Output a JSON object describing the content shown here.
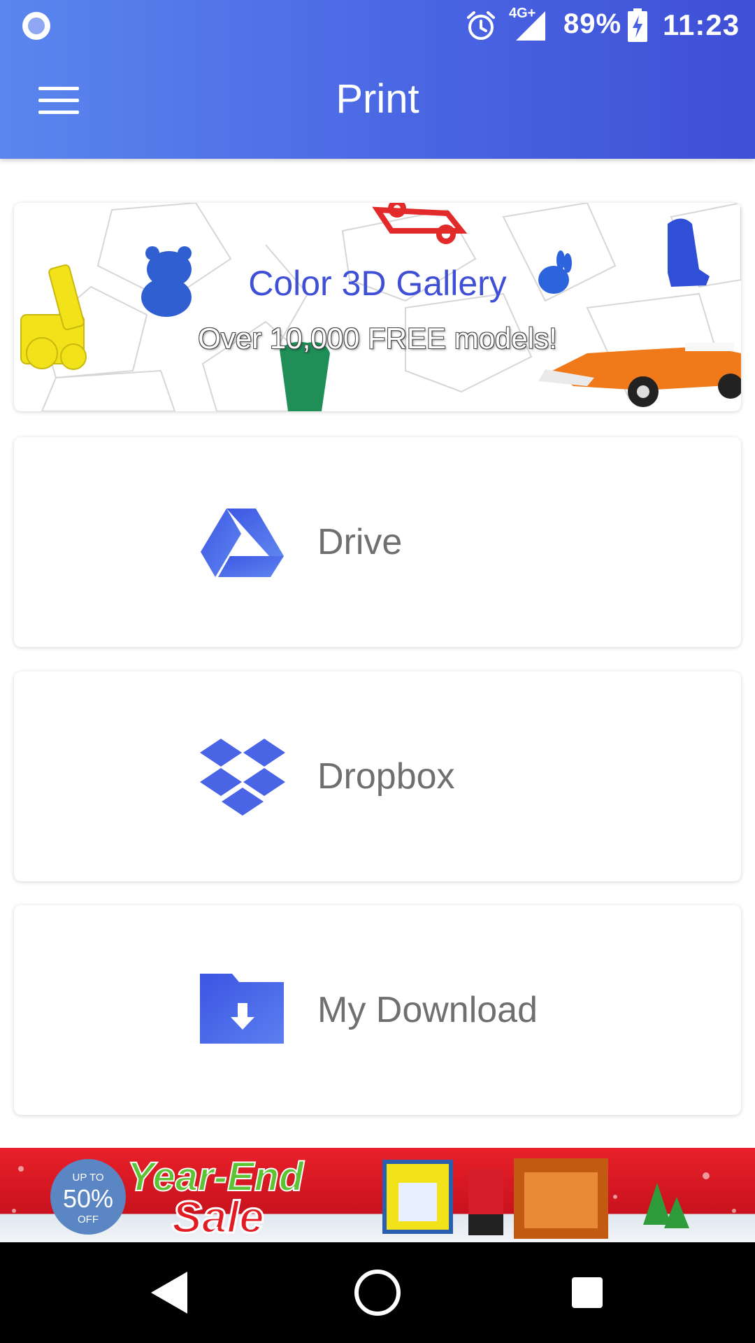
{
  "status_bar": {
    "network": "4G+",
    "battery": "89%",
    "time": "11:23"
  },
  "app_bar": {
    "title": "Print"
  },
  "gallery_banner": {
    "title": "Color 3D Gallery",
    "subtitle": "Over 10,000 FREE models!"
  },
  "sources": [
    {
      "label": "Drive",
      "icon": "google-drive-icon"
    },
    {
      "label": "Dropbox",
      "icon": "dropbox-icon"
    },
    {
      "label": "My Download",
      "icon": "download-folder-icon"
    }
  ],
  "ad_banner": {
    "badge_top": "UP TO",
    "badge_value": "50%",
    "badge_bottom": "OFF",
    "line1": "Year-End",
    "line2": "Sale"
  },
  "colors": {
    "app_bar_start": "#5a86ee",
    "app_bar_end": "#3f4fd6",
    "icon_blue": "#4a64e6",
    "label_gray": "#6f6f6f"
  }
}
